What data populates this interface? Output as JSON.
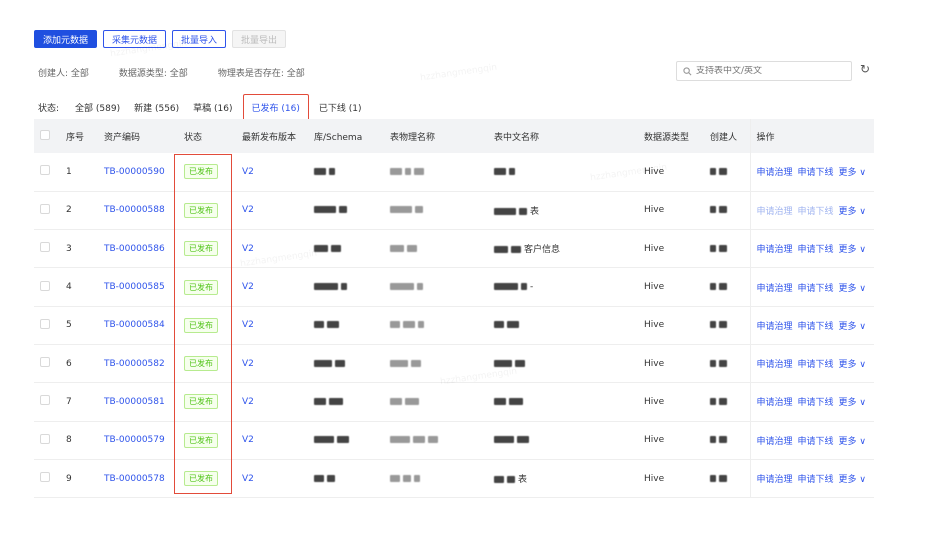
{
  "toolbar": {
    "add_label": "添加元数据",
    "collect_label": "采集元数据",
    "import_label": "批量导入",
    "export_label": "批量导出"
  },
  "filters": {
    "creator": "创建人: 全部",
    "source_type": "数据源类型: 全部",
    "physical_exists": "物理表是否存在: 全部"
  },
  "search": {
    "placeholder": "支持表中文/英文"
  },
  "status": {
    "label": "状态:",
    "tabs": [
      {
        "label": "全部 (589)"
      },
      {
        "label": "新建 (556)"
      },
      {
        "label": "草稿 (16)"
      },
      {
        "label": "已发布 (16)"
      },
      {
        "label": "已下线 (1)"
      }
    ]
  },
  "table": {
    "headers": [
      "序号",
      "资产编码",
      "状态",
      "最新发布版本",
      "库/Schema",
      "表物理名称",
      "表中文名称",
      "数据源类型",
      "创建人",
      "操作"
    ],
    "rows": [
      {
        "no": "1",
        "code": "TB-00000590",
        "status": "已发布",
        "version": "V2",
        "cn_name": "",
        "type": "Hive",
        "ops_dim": false
      },
      {
        "no": "2",
        "code": "TB-00000588",
        "status": "已发布",
        "version": "V2",
        "cn_name": "表",
        "type": "Hive",
        "ops_dim": true
      },
      {
        "no": "3",
        "code": "TB-00000586",
        "status": "已发布",
        "version": "V2",
        "cn_name": "客户信息",
        "type": "Hive",
        "ops_dim": false
      },
      {
        "no": "4",
        "code": "TB-00000585",
        "status": "已发布",
        "version": "V2",
        "cn_name": "-",
        "type": "Hive",
        "ops_dim": false
      },
      {
        "no": "5",
        "code": "TB-00000584",
        "status": "已发布",
        "version": "V2",
        "cn_name": "",
        "type": "Hive",
        "ops_dim": false
      },
      {
        "no": "6",
        "code": "TB-00000582",
        "status": "已发布",
        "version": "V2",
        "cn_name": "",
        "type": "Hive",
        "ops_dim": false
      },
      {
        "no": "7",
        "code": "TB-00000581",
        "status": "已发布",
        "version": "V2",
        "cn_name": "",
        "type": "Hive",
        "ops_dim": false
      },
      {
        "no": "8",
        "code": "TB-00000579",
        "status": "已发布",
        "version": "V2",
        "cn_name": "",
        "type": "Hive",
        "ops_dim": false
      },
      {
        "no": "9",
        "code": "TB-00000578",
        "status": "已发布",
        "version": "V2",
        "cn_name": "表",
        "type": "Hive",
        "ops_dim": false
      }
    ],
    "ops": {
      "apply": "申请治理",
      "offline": "申请下线",
      "more": "更多 ∨"
    }
  },
  "colors": {
    "accent": "#2f54eb",
    "highlight": "#e24b3a",
    "success": "#52c41a"
  },
  "icons": {
    "search": "search-icon",
    "refresh": "refresh-icon"
  }
}
